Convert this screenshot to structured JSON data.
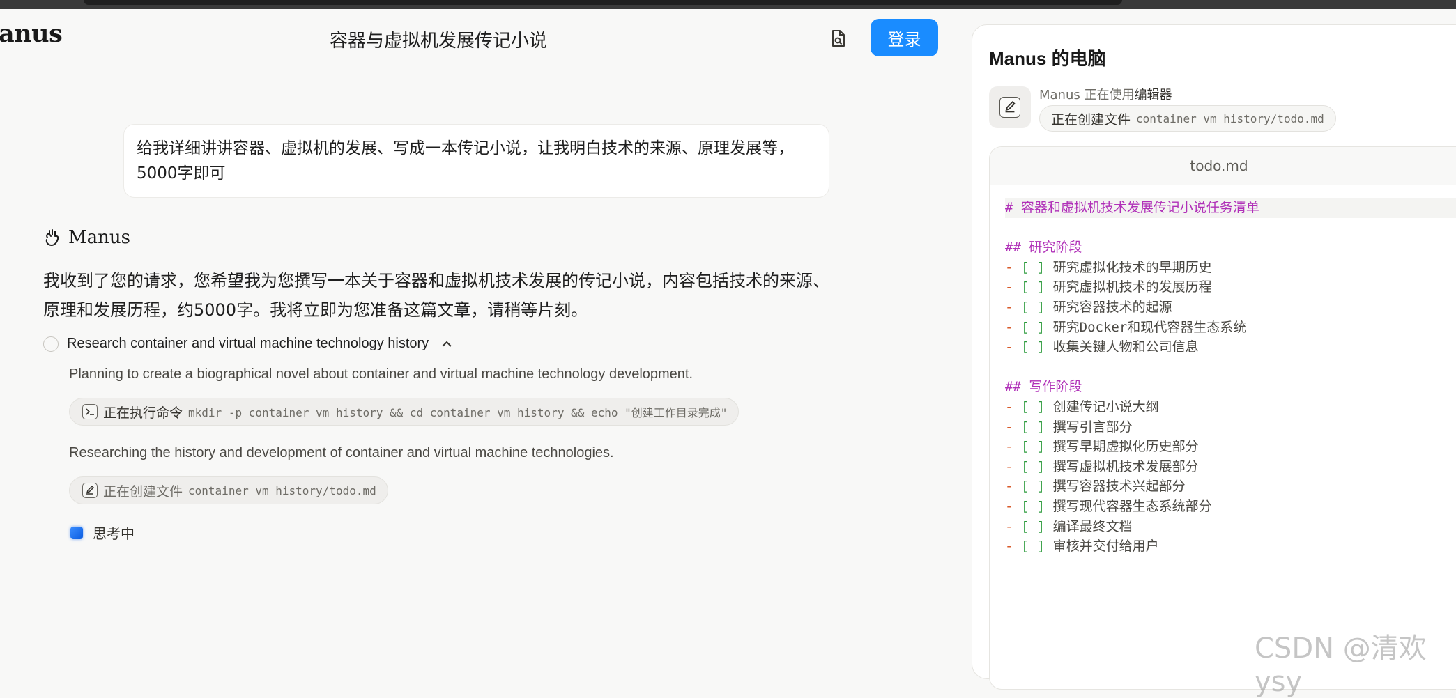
{
  "app": {
    "logo": "anus",
    "title": "容器与虚拟机发展传记小说",
    "login_label": "登录"
  },
  "chat": {
    "user_message": "给我详细讲讲容器、虚拟机的发展、写成一本传记小说，让我明白技术的来源、原理发展等，5000字即可",
    "agent_name": "Manus",
    "agent_message": "我收到了您的请求，您希望我为您撰写一本关于容器和虚拟机技术发展的传记小说，内容包括技术的来源、原理和发展历程，约5000字。我将立即为您准备这篇文章，请稍等片刻。",
    "task_title": "Research container and virtual machine technology history",
    "step1_text": "Planning to create a biographical novel about container and virtual machine technology development.",
    "step1_action_label": "正在执行命令",
    "step1_action_code": "mkdir -p container_vm_history && cd container_vm_history && echo \"创建工作目录完成\"",
    "step2_text": "Researching the history and development of container and virtual machine technologies.",
    "step2_action_label": "正在创建文件",
    "step2_action_code": "container_vm_history/todo.md",
    "thinking_label": "思考中"
  },
  "panel": {
    "title": "Manus 的电脑",
    "status_prefix": "Manus 正在使用",
    "status_tool": "编辑器",
    "action_label": "正在创建文件",
    "action_code": "container_vm_history/todo.md",
    "file_name": "todo.md",
    "lines": [
      {
        "kind": "h1",
        "mark": "#",
        "text": "容器和虚拟机技术发展传记小说任务清单"
      },
      {
        "kind": "blank"
      },
      {
        "kind": "h2",
        "mark": "##",
        "text": "研究阶段"
      },
      {
        "kind": "item",
        "text": "研究虚拟化技术的早期历史"
      },
      {
        "kind": "item",
        "text": "研究虚拟机技术的发展历程"
      },
      {
        "kind": "item",
        "text": "研究容器技术的起源"
      },
      {
        "kind": "item",
        "text": "研究Docker和现代容器生态系统"
      },
      {
        "kind": "item",
        "text": "收集关键人物和公司信息"
      },
      {
        "kind": "blank"
      },
      {
        "kind": "h2",
        "mark": "##",
        "text": "写作阶段"
      },
      {
        "kind": "item",
        "text": "创建传记小说大纲"
      },
      {
        "kind": "item",
        "text": "撰写引言部分"
      },
      {
        "kind": "item",
        "text": "撰写早期虚拟化历史部分"
      },
      {
        "kind": "item",
        "text": "撰写虚拟机技术发展部分"
      },
      {
        "kind": "item",
        "text": "撰写容器技术兴起部分"
      },
      {
        "kind": "item",
        "text": "撰写现代容器生态系统部分"
      },
      {
        "kind": "item",
        "text": "编译最终文档"
      },
      {
        "kind": "item",
        "text": "审核并交付给用户"
      }
    ]
  },
  "watermark": "CSDN @清欢ysy",
  "icons": {
    "share": "share-file-icon",
    "agent": "manus-hand-icon",
    "terminal": "terminal-icon",
    "editor": "edit-icon"
  },
  "colors": {
    "accent": "#1a8cff",
    "heading": "#b030b8",
    "checkbox": "#2a9a3a",
    "bullet": "#d85a2a"
  }
}
